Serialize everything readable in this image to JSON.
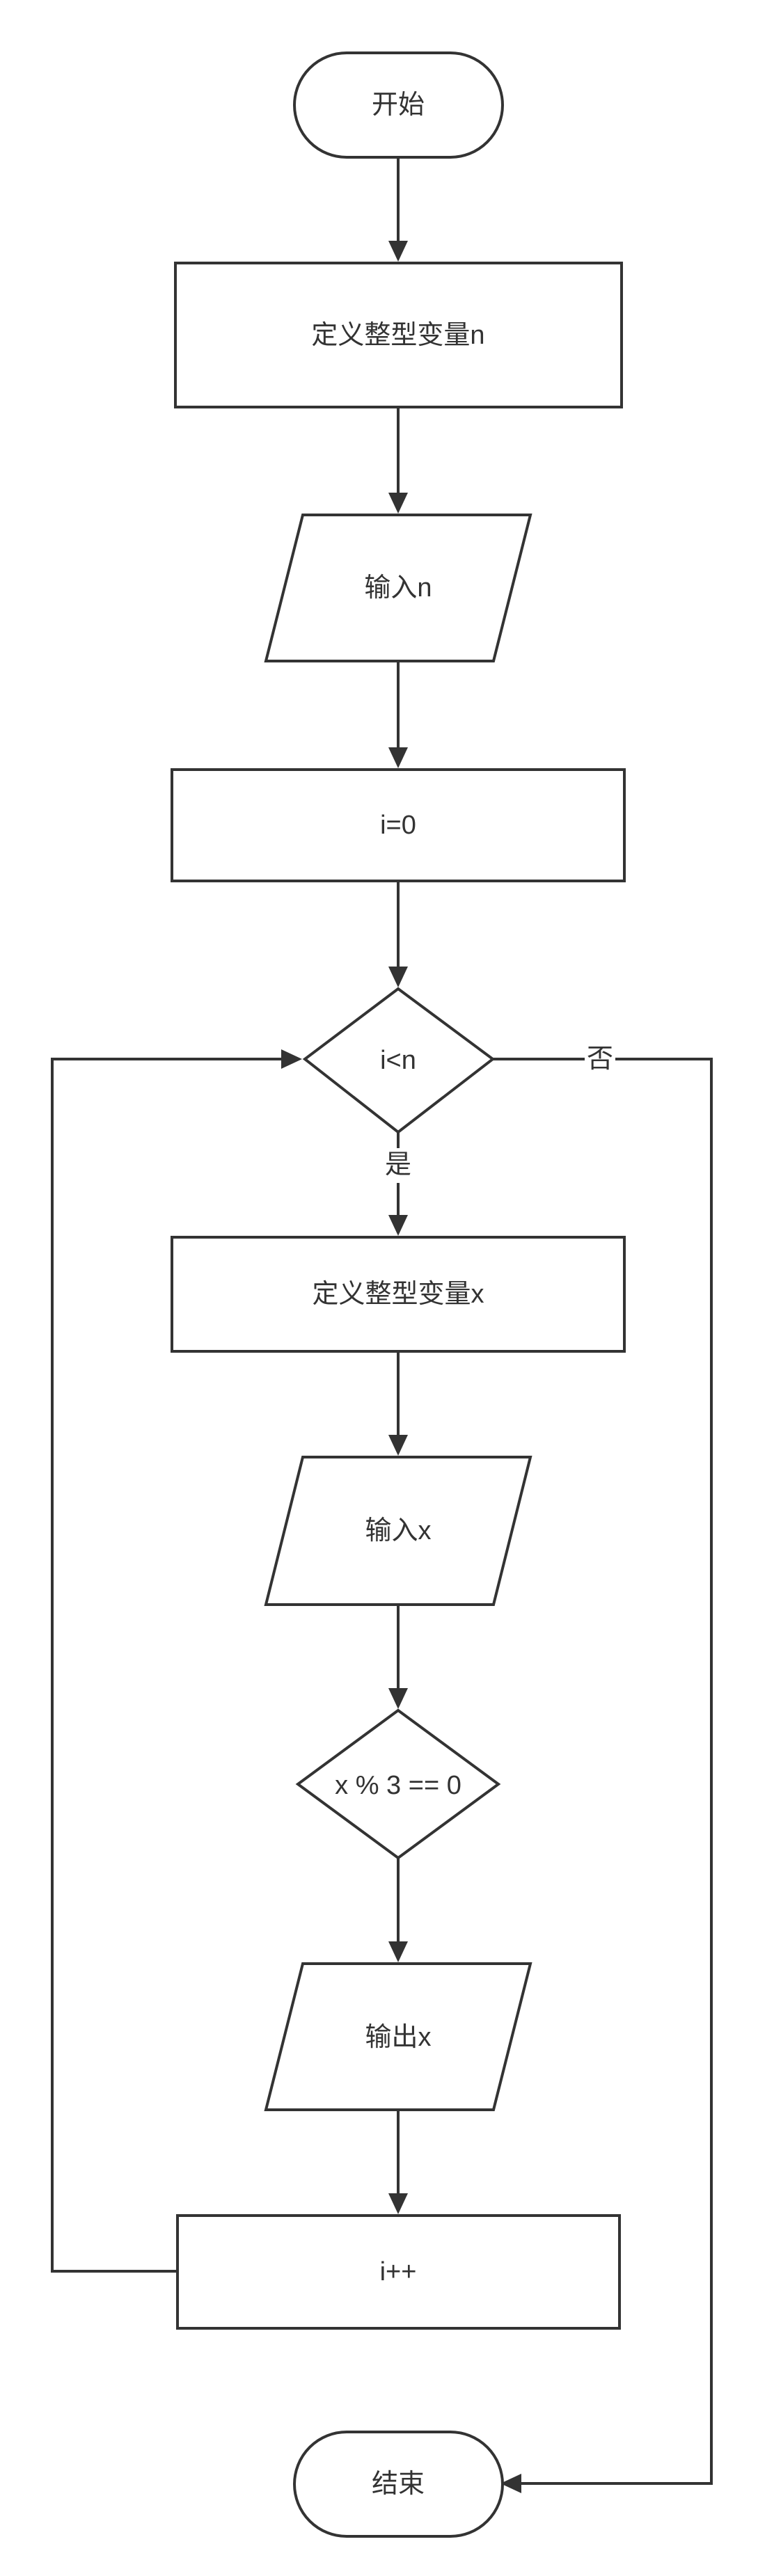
{
  "flowchart": {
    "nodes": {
      "start": "开始",
      "define_n": "定义整型变量n",
      "input_n": "输入n",
      "init_i": "i=0",
      "cond_loop": "i<n",
      "define_x": "定义整型变量x",
      "input_x": "输入x",
      "cond_mod": "x % 3 == 0",
      "output_x": "输出x",
      "increment": "i++",
      "end": "结束"
    },
    "edge_labels": {
      "yes": "是",
      "no": "否"
    }
  }
}
